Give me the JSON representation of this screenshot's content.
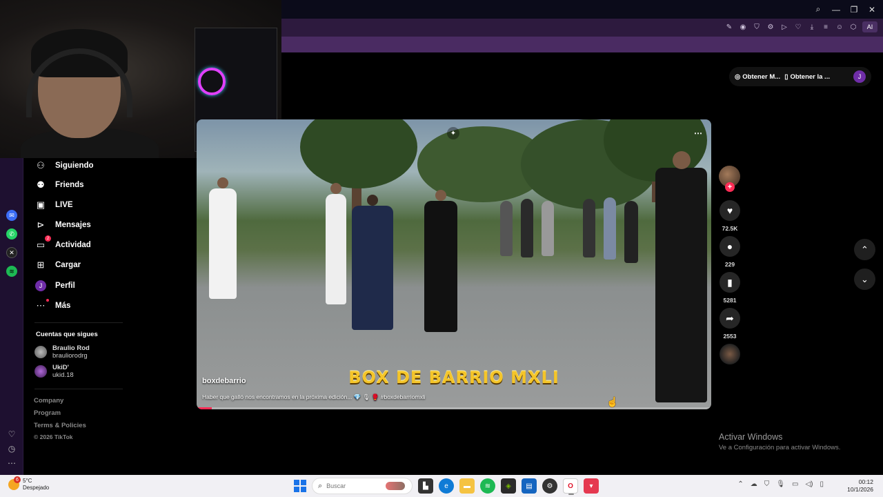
{
  "browser": {
    "window_controls": [
      "search",
      "minimize",
      "maximize",
      "close"
    ],
    "toolbar_ai_label": "AI"
  },
  "nav": {
    "items": [
      {
        "label": "Siguiendo",
        "icon": "following-icon"
      },
      {
        "label": "Friends",
        "icon": "friends-icon"
      },
      {
        "label": "LIVE",
        "icon": "live-icon"
      },
      {
        "label": "Mensajes",
        "icon": "messages-icon"
      },
      {
        "label": "Actividad",
        "icon": "activity-icon",
        "badge": "2"
      },
      {
        "label": "Cargar",
        "icon": "upload-icon"
      },
      {
        "label": "Perfil",
        "icon": "profile-avatar",
        "avatar_letter": "J"
      },
      {
        "label": "Más",
        "icon": "more-icon"
      }
    ],
    "following_title": "Cuentas que sigues",
    "accounts": [
      {
        "name": "Braulio Rod",
        "handle": "brauliorodrg"
      },
      {
        "name": "UkiD'",
        "handle": "ukid.18"
      }
    ],
    "footer": {
      "company": "Company",
      "program": "Program",
      "terms": "Terms & Policies",
      "copyright": "© 2026 TikTok"
    }
  },
  "top_pill": {
    "btn1": "Obtener M...",
    "btn2": "Obtener la ...",
    "avatar_letter": "J"
  },
  "video": {
    "overlay_title": "BOX DE BARRIO MXLI",
    "author": "boxdebarrio",
    "caption": "Haber que galló nos encontramos en la próxima edición... 💎 🎙 🥊 #boxdebarriomxli",
    "progress_fraction": 0.03
  },
  "actions": {
    "likes": "72.5K",
    "comments": "229",
    "saves": "5281",
    "shares": "2553"
  },
  "activate_windows": {
    "title": "Activar Windows",
    "subtitle": "Ve a Configuración para activar Windows."
  },
  "taskbar": {
    "temperature": "5°C",
    "condition": "Despejado",
    "weather_badge": "6",
    "search_placeholder": "Buscar",
    "time": "00:12",
    "date": "10/1/2026"
  },
  "colors": {
    "accent": "#fe2c55",
    "browser_toolbar": "#2d1a3e",
    "bookmark_bar": "#4a2b62",
    "overlay_title": "#f4c52a"
  }
}
